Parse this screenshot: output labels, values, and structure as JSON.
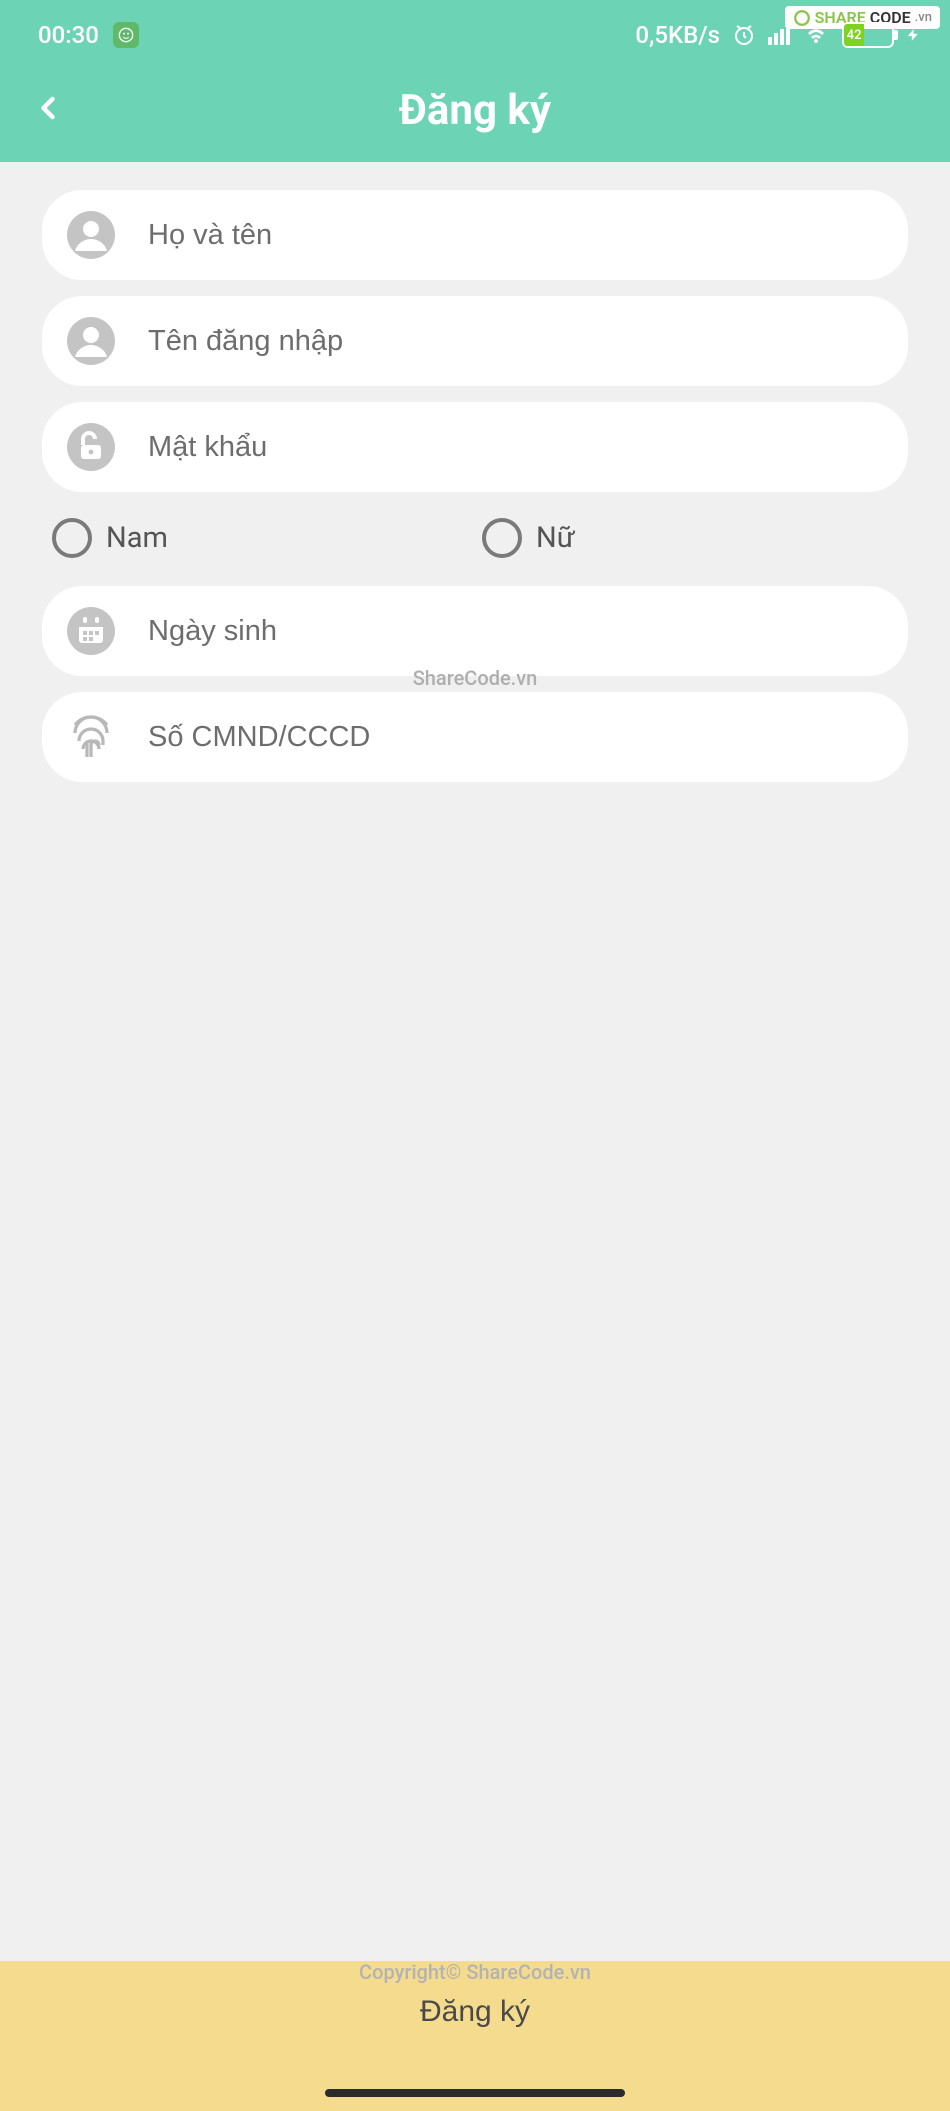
{
  "status": {
    "time": "00:30",
    "net_speed": "0,5KB/s",
    "battery_pct": "42"
  },
  "watermark": {
    "brand_part1": "SHARE",
    "brand_part2": "CODE",
    "brand_suffix": ".vn",
    "mid": "ShareCode.vn",
    "bottom": "Copyright© ShareCode.vn"
  },
  "header": {
    "title": "Đăng ký"
  },
  "form": {
    "fullname_ph": "Họ và tên",
    "username_ph": "Tên đăng nhập",
    "password_ph": "Mật khẩu",
    "gender_male": "Nam",
    "gender_female": "Nữ",
    "dob_ph": "Ngày sinh",
    "idcard_ph": "Số CMND/CCCD"
  },
  "submit": {
    "label": "Đăng ký"
  }
}
